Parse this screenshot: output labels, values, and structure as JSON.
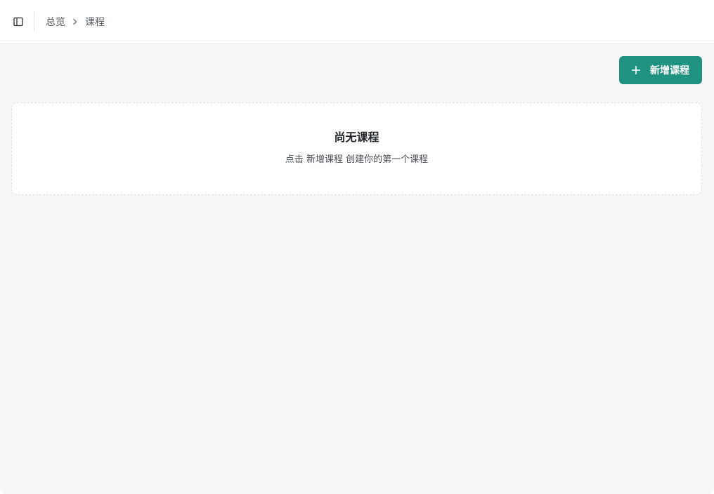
{
  "header": {
    "breadcrumb": {
      "parent": "总览",
      "current": "课程"
    },
    "icons": {
      "sidebar_toggle": "sidebar-toggle-icon",
      "separator": "chevron-right-icon"
    }
  },
  "toolbar": {
    "add_button_label": "新增课程",
    "add_button_icon": "plus-icon"
  },
  "empty_state": {
    "title": "尚无课程",
    "description": "点击 新增课程 创建你的第一个课程"
  },
  "colors": {
    "accent": "#1f9282",
    "background": "#f6f6f6",
    "card": "#ffffff"
  }
}
